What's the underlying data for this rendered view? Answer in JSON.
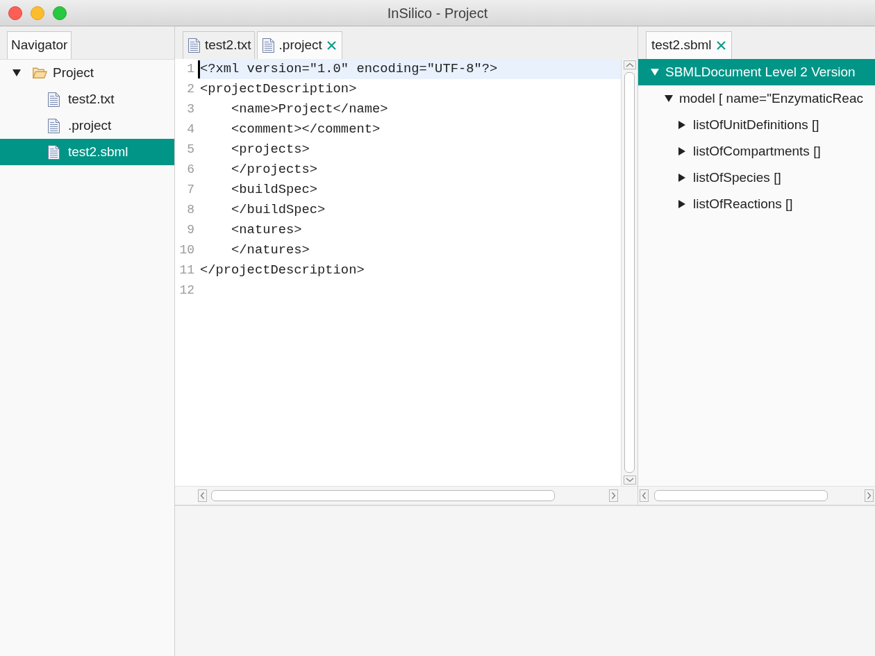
{
  "window": {
    "title": "InSilico - Project"
  },
  "navigator": {
    "tabs": [
      {
        "label": "Navigator",
        "selected": true
      }
    ],
    "tree": [
      {
        "label": "Project",
        "kind": "folder",
        "expanded": true,
        "selected": false,
        "children": [
          {
            "label": "test2.txt",
            "kind": "file",
            "selected": false
          },
          {
            "label": ".project",
            "kind": "file",
            "selected": false
          },
          {
            "label": "test2.sbml",
            "kind": "file",
            "selected": true
          }
        ]
      }
    ]
  },
  "editor": {
    "tabs": [
      {
        "label": "test2.txt",
        "selected": false
      },
      {
        "label": ".project",
        "selected": true
      }
    ],
    "lines": [
      {
        "number": "1",
        "text": "<?xml version=\"1.0\" encoding=\"UTF-8\"?>",
        "current": true
      },
      {
        "number": "2",
        "text": "<projectDescription>",
        "current": false
      },
      {
        "number": "3",
        "text": "    <name>Project</name>",
        "current": false
      },
      {
        "number": "4",
        "text": "    <comment></comment>",
        "current": false
      },
      {
        "number": "5",
        "text": "    <projects>",
        "current": false
      },
      {
        "number": "6",
        "text": "    </projects>",
        "current": false
      },
      {
        "number": "7",
        "text": "    <buildSpec>",
        "current": false
      },
      {
        "number": "8",
        "text": "    </buildSpec>",
        "current": false
      },
      {
        "number": "9",
        "text": "    <natures>",
        "current": false
      },
      {
        "number": "10",
        "text": "    </natures>",
        "current": false
      },
      {
        "number": "11",
        "text": "</projectDescription>",
        "current": false
      },
      {
        "number": "12",
        "current": false
      }
    ]
  },
  "outline": {
    "tabs": [
      {
        "label": "test2.sbml",
        "selected": true
      }
    ],
    "tree": [
      {
        "label": "SBMLDocument Level 2 Version",
        "expanded": true,
        "selected": true,
        "children": [
          {
            "label": "model [ name=\"EnzymaticReac",
            "expanded": true,
            "selected": false,
            "children": [
              {
                "label": "listOfUnitDefinitions []",
                "expanded": false,
                "selected": false
              },
              {
                "label": "listOfCompartments []",
                "expanded": false,
                "selected": false
              },
              {
                "label": "listOfSpecies []",
                "expanded": false,
                "selected": false
              },
              {
                "label": "listOfReactions []",
                "expanded": false,
                "selected": false
              }
            ]
          }
        ]
      }
    ]
  }
}
